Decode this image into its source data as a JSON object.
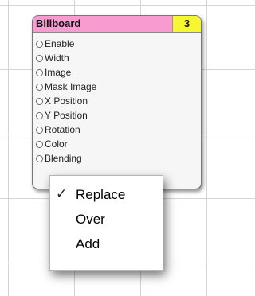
{
  "patch": {
    "title": "Billboard",
    "badge": "3",
    "ports": [
      {
        "label": "Enable"
      },
      {
        "label": "Width"
      },
      {
        "label": "Image"
      },
      {
        "label": "Mask Image"
      },
      {
        "label": "X Position"
      },
      {
        "label": "Y Position"
      },
      {
        "label": "Rotation"
      },
      {
        "label": "Color"
      },
      {
        "label": "Blending"
      }
    ]
  },
  "menu": {
    "items": [
      {
        "label": "Replace",
        "checked": true
      },
      {
        "label": "Over",
        "checked": false
      },
      {
        "label": "Add",
        "checked": false
      }
    ],
    "check_glyph": "✓"
  },
  "colors": {
    "header": "#f79bd0",
    "badge": "#f6f631"
  }
}
